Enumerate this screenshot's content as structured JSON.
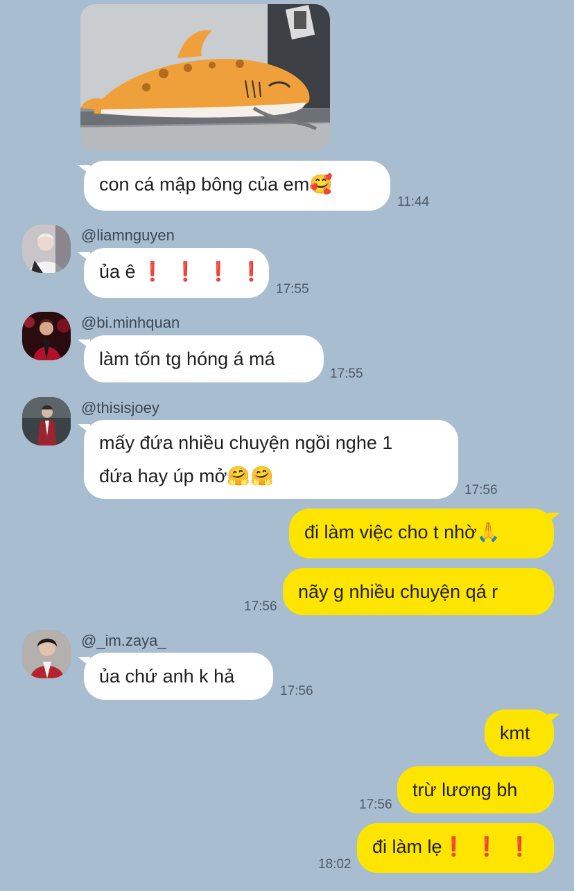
{
  "messages": {
    "m1": {
      "text": "con cá mập bông của em",
      "emoji": "🥰",
      "time": "11:44"
    },
    "m2": {
      "sender": "@liamnguyen",
      "text": "ủa ê",
      "emoji": "❗❗❗❗",
      "time": "17:55"
    },
    "m3": {
      "sender": "@bi.minhquan",
      "text": "làm tốn tg hóng á má",
      "time": "17:55"
    },
    "m4": {
      "sender": "@thisisjoey",
      "line1": "mấy đứa nhiều chuyện ngồi nghe 1",
      "line2": "đứa hay úp mở",
      "emoji": "🤗🤗",
      "time": "17:56"
    },
    "m5": {
      "text": "đi làm việc cho t nhờ",
      "emoji": "🙏"
    },
    "m6": {
      "text": "nãy g nhiều chuyện qá r",
      "time": "17:56"
    },
    "m7": {
      "sender": "@_im.zaya_",
      "text": "ủa chứ anh k hả",
      "time": "17:56"
    },
    "m8": {
      "text": "kmt"
    },
    "m9": {
      "text": "trừ lương bh",
      "time": "17:56"
    },
    "m10": {
      "text": "đi làm lẹ",
      "emoji": "❗❗❗",
      "time": "18:02"
    }
  },
  "colors": {
    "background": "#a9bdd1",
    "my_bubble": "#fee500",
    "other_bubble": "#ffffff"
  },
  "icons": {
    "photo": "plush-shark-photo",
    "avatars": [
      "avatar-liamnguyen",
      "avatar-biminhquan",
      "avatar-thisisjoey",
      "avatar-imzaya"
    ]
  }
}
